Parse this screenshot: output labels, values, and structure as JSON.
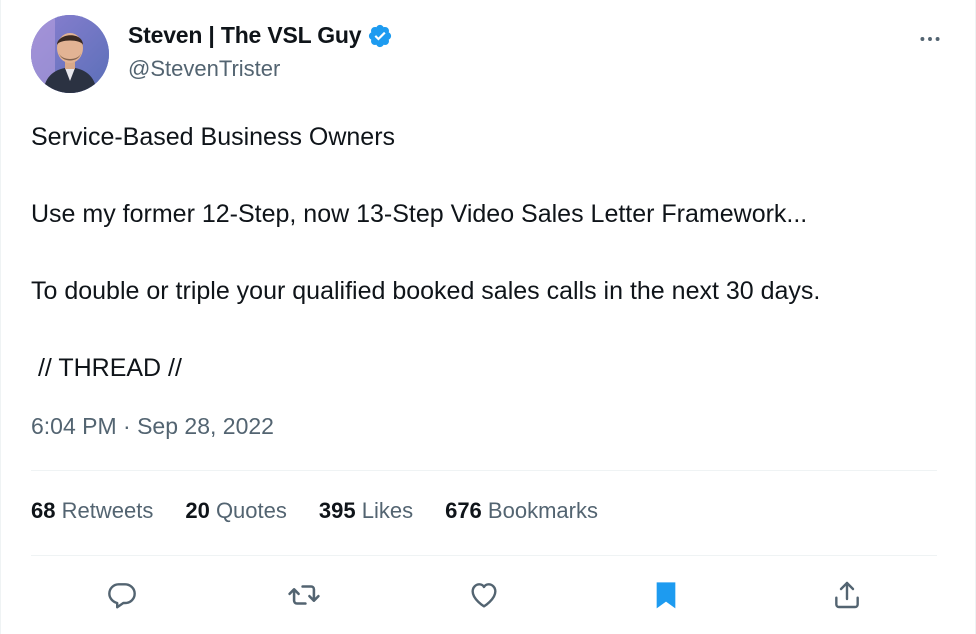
{
  "author": {
    "display_name": "Steven | The VSL Guy",
    "handle": "@StevenTrister",
    "verified": true
  },
  "tweet": {
    "lines": [
      "Service-Based Business Owners",
      "Use my former 12-Step, now 13-Step Video Sales Letter Framework...",
      "To double or triple your qualified booked sales calls in the next 30 days.",
      " // THREAD //"
    ],
    "timestamp": "6:04 PM · Sep 28, 2022"
  },
  "stats": [
    {
      "count": "68",
      "label": "Retweets"
    },
    {
      "count": "20",
      "label": "Quotes"
    },
    {
      "count": "395",
      "label": "Likes"
    },
    {
      "count": "676",
      "label": "Bookmarks"
    }
  ],
  "icons": {
    "more": "more-horizontal-icon",
    "reply": "reply-icon",
    "retweet": "retweet-icon",
    "like": "heart-icon",
    "bookmark": "bookmark-icon",
    "share": "share-icon",
    "verified": "verified-badge-icon"
  },
  "colors": {
    "text_primary": "#0f1419",
    "text_secondary": "#536471",
    "accent_blue": "#1d9bf0",
    "divider": "#eff3f4"
  }
}
